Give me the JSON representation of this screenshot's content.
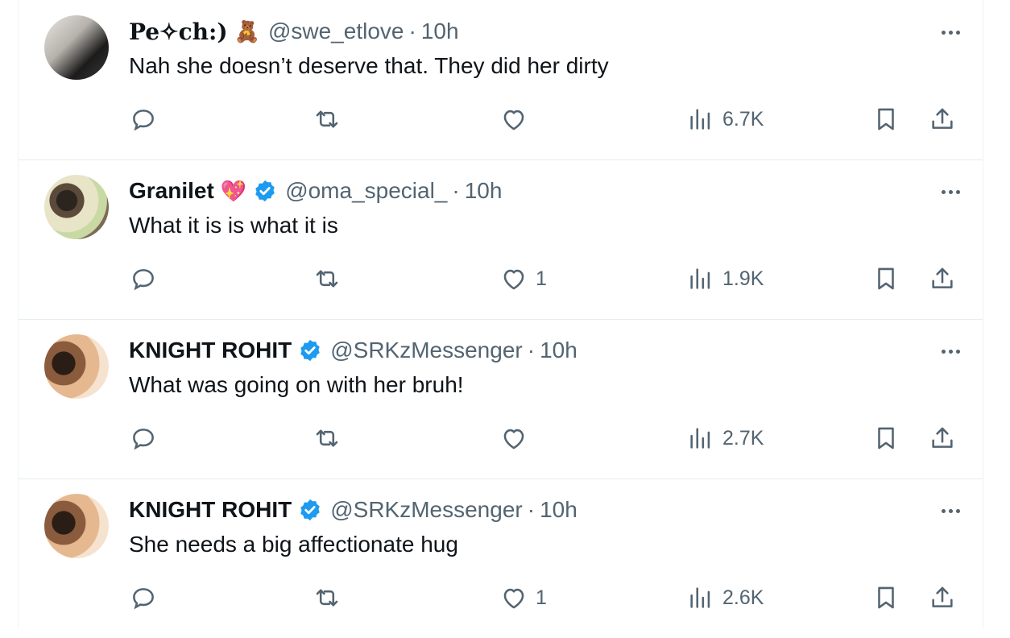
{
  "tweets": [
    {
      "avatar_desc": "user-avatar",
      "name": "Pe✧ch:)",
      "name_emoji": "🧸",
      "verified": false,
      "handle": "@swe_etlove",
      "dot": "·",
      "time": "10h",
      "text": "Nah she doesn’t deserve that. They did her dirty",
      "likes": "",
      "views": "6.7K"
    },
    {
      "avatar_desc": "user-avatar",
      "name": "Granilet",
      "name_emoji": "💖",
      "verified": true,
      "handle": "@oma_special_",
      "dot": "·",
      "time": "10h",
      "text": "What it is is what it is",
      "likes": "1",
      "views": "1.9K"
    },
    {
      "avatar_desc": "user-avatar",
      "name": "KNIGHT ROHIT",
      "name_emoji": "",
      "verified": true,
      "handle": "@SRKzMessenger",
      "dot": "·",
      "time": "10h",
      "text": "What was going on with her bruh!",
      "likes": "",
      "views": "2.7K"
    },
    {
      "avatar_desc": "user-avatar",
      "name": "KNIGHT ROHIT",
      "name_emoji": "",
      "verified": true,
      "handle": "@SRKzMessenger",
      "dot": "·",
      "time": "10h",
      "text": "She needs a big affectionate hug",
      "likes": "1",
      "views": "2.6K"
    }
  ],
  "icons": {
    "reply": "reply-icon",
    "retweet": "retweet-icon",
    "like": "heart-icon",
    "views": "views-icon",
    "bookmark": "bookmark-icon",
    "share": "share-icon",
    "more": "more-icon",
    "verified": "verified-badge-icon"
  },
  "colors": {
    "text_primary": "#0f1419",
    "text_secondary": "#536471",
    "verified_blue": "#1d9bf0",
    "divider": "#e6ecf0"
  }
}
